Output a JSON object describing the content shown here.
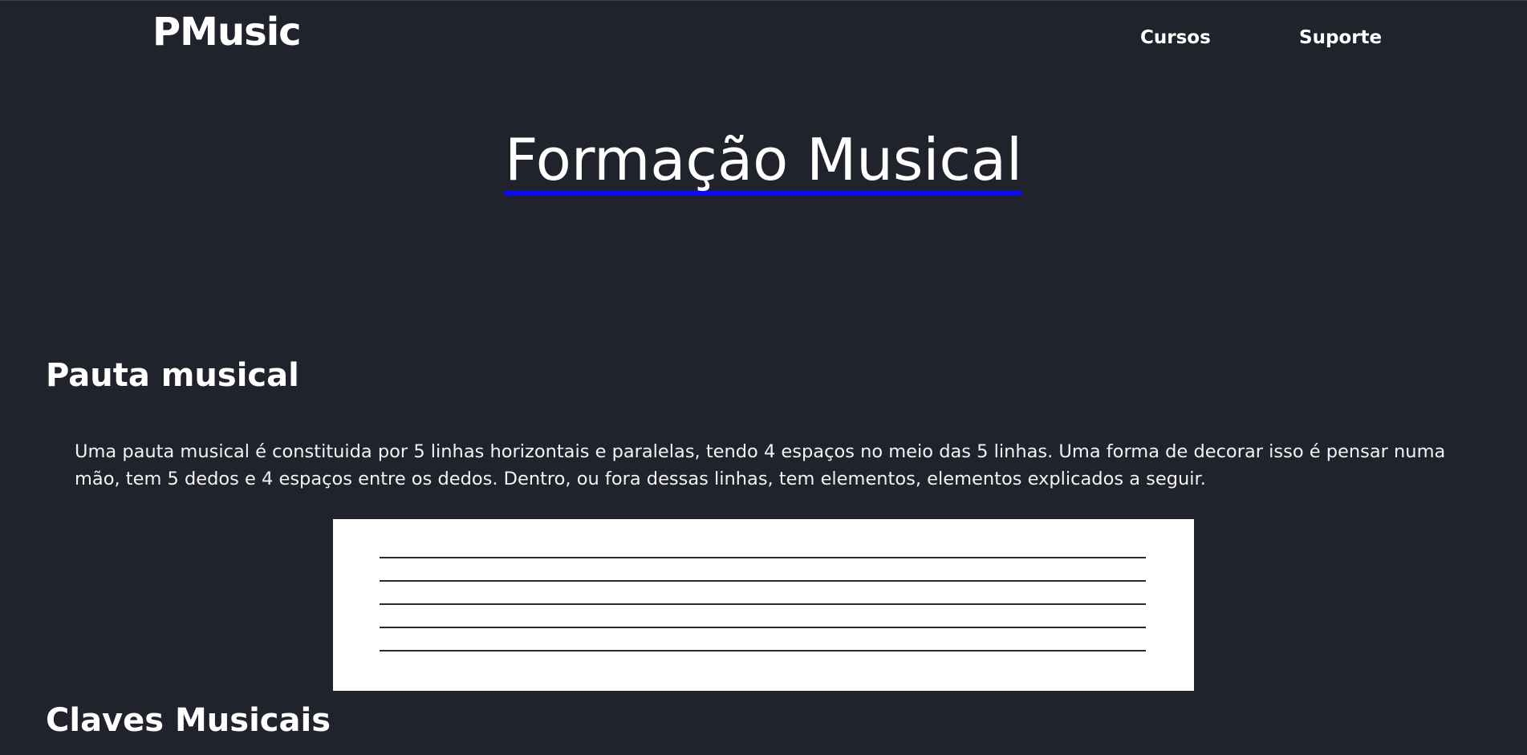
{
  "header": {
    "brand": "PMusic",
    "nav": [
      "Cursos",
      "Suporte"
    ]
  },
  "hero": {
    "title": "Formação Musical"
  },
  "sections": [
    {
      "heading": "Pauta musical",
      "paragraph": "Uma pauta musical é constituida por 5 linhas horizontais e paralelas, tendo 4 espaços no meio das 5 linhas. Uma forma de decorar isso é pensar numa mão, tem 5 dedos e 4 espaços entre os dedos. Dentro, ou fora dessas linhas, tem elementos, elementos explicados a seguir."
    },
    {
      "heading": "Claves Musicais"
    }
  ],
  "colors": {
    "background": "#20232b",
    "title_underline": "#0a0aff",
    "staff_bg": "#ffffff"
  }
}
